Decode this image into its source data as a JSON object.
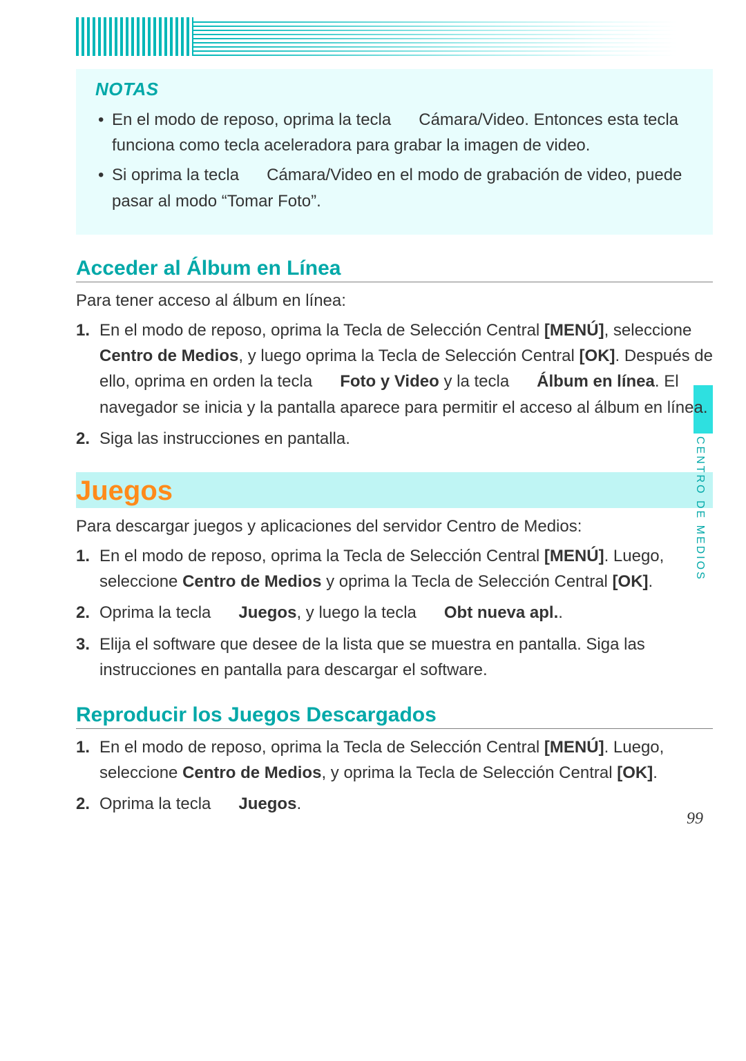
{
  "sideTab": "CENTRO DE MEDIOS",
  "pageNumber": "99",
  "notas": {
    "heading": "NOTAS",
    "items": [
      {
        "pre": "En el modo de reposo, oprima la tecla ",
        "mid": "Cámara/Video. Entonces esta tecla funciona como tecla aceleradora para grabar la imagen de video."
      },
      {
        "pre": "Si oprima la tecla ",
        "mid": "Cámara/Video en el modo de grabación de video, puede pasar al modo “Tomar Foto”."
      }
    ]
  },
  "album": {
    "heading": "Acceder al Álbum en Línea",
    "intro": "Para tener acceso al álbum en línea:",
    "steps": {
      "s1": {
        "t1": "En el modo de reposo, oprima la Tecla de Selección Central ",
        "b1": "[MENÚ]",
        "t2": ", seleccione ",
        "b2": "Centro de Medios",
        "t3": ", y luego oprima la Tecla de Selección Central ",
        "b3": "[OK]",
        "t4": ". Después de ello, oprima en orden la tecla ",
        "b4": "Foto y Video",
        "t5": " y la tecla ",
        "b5": "Álbum en línea",
        "t6": ". El navegador se inicia y la pantalla aparece para permitir el acceso al álbum en línea."
      },
      "s2": "Siga las instrucciones en pantalla."
    }
  },
  "juegos": {
    "heading": "Juegos",
    "intro": "Para descargar juegos y aplicaciones del servidor Centro de Medios:",
    "steps": {
      "s1": {
        "t1": "En el modo de reposo, oprima la Tecla de Selección Central ",
        "b1": "[MENÚ]",
        "t2": ". Luego, seleccione ",
        "b2": "Centro de Medios",
        "t3": " y oprima la Tecla de Selección Central ",
        "b3": "[OK]",
        "t4": "."
      },
      "s2": {
        "t1": "Oprima la tecla ",
        "b1": "Juegos",
        "t2": ", y luego la tecla ",
        "b2": "Obt nueva apl.",
        "t3": "."
      },
      "s3": "Elija el software que desee de la lista que se muestra en pantalla. Siga las instrucciones en pantalla para descargar el software."
    }
  },
  "reproducir": {
    "heading": "Reproducir los Juegos Descargados",
    "steps": {
      "s1": {
        "t1": "En el modo de reposo, oprima la Tecla de Selección Central ",
        "b1": "[MENÚ]",
        "t2": ". Luego, seleccione ",
        "b2": "Centro de Medios",
        "t3": ", y oprima la Tecla de Selección Central ",
        "b3": "[OK]",
        "t4": "."
      },
      "s2": {
        "t1": "Oprima la tecla ",
        "b1": "Juegos",
        "t2": "."
      }
    }
  },
  "nums": {
    "n1": "1.",
    "n2": "2.",
    "n3": "3."
  }
}
